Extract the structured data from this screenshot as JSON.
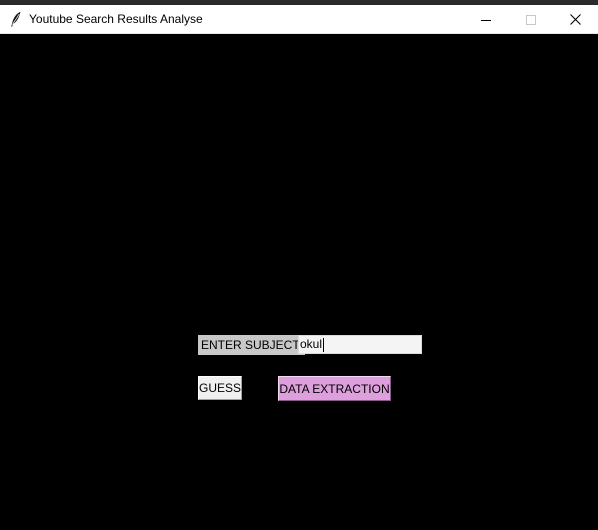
{
  "window": {
    "title": "Youtube Search Results Analyse",
    "icon": "feather-icon",
    "controls": [
      "minimize-icon",
      "maximize-icon",
      "close-icon"
    ]
  },
  "form": {
    "subject_label": "ENTER SUBJECT:",
    "subject_value": "okul",
    "guess_label": "GUESS",
    "data_extraction_label": "DATA EXTRACTION"
  },
  "colors": {
    "background": "#000000",
    "label_bg": "#c8c8c8",
    "data_button_bg": "#dda0dd",
    "guess_button_bg": "#f0f0f0"
  }
}
